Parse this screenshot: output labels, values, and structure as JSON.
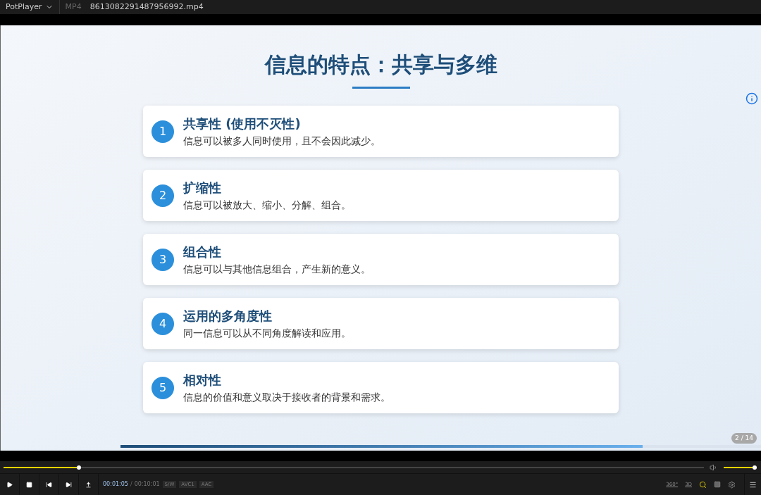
{
  "window": {
    "app_menu": "PotPlayer",
    "format": "MP4",
    "file_name": "8613082291487956992.mp4"
  },
  "slide": {
    "title": "信息的特点：共享与多维",
    "items": [
      {
        "number": "1",
        "heading": "共享性 (使用不灭性)",
        "text": "信息可以被多人同时使用，且不会因此减少。"
      },
      {
        "number": "2",
        "heading": "扩缩性",
        "text": "信息可以被放大、缩小、分解、组合。"
      },
      {
        "number": "3",
        "heading": "组合性",
        "text": "信息可以与其他信息组合，产生新的意义。"
      },
      {
        "number": "4",
        "heading": "运用的多角度性",
        "text": "同一信息可以从不同角度解读和应用。"
      },
      {
        "number": "5",
        "heading": "相对性",
        "text": "信息的价值和意义取决于接收者的背景和需求。"
      }
    ],
    "page_counter": "2 / 14",
    "progress": {
      "level": 0.815
    }
  },
  "player": {
    "seek": {
      "level": 0.108
    },
    "volume": {
      "level": 1
    },
    "current_time": "00:01:05",
    "separator": "/",
    "total_time": "00:10:01",
    "tags": [
      "S/W",
      "AVC1",
      "AAC"
    ],
    "badges": [
      "360°",
      "3D"
    ]
  }
}
